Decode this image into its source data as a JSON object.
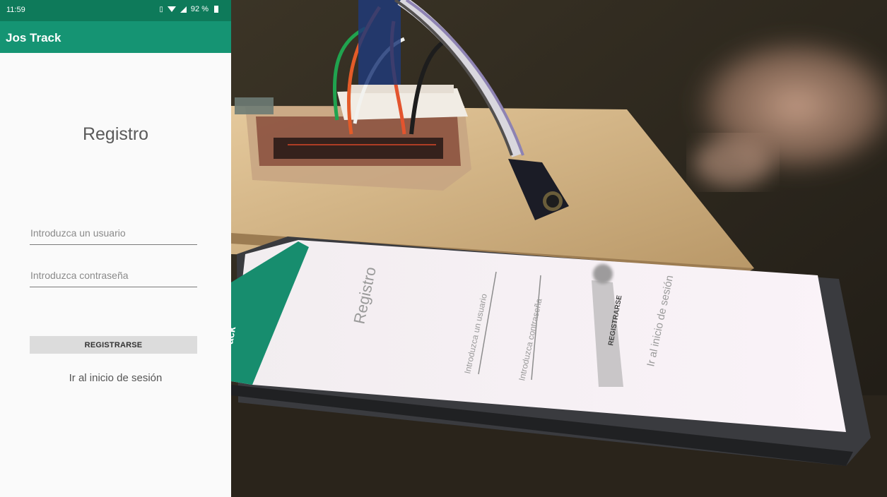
{
  "status_bar": {
    "time": "11:59",
    "battery": "92 %",
    "icons": [
      "vibrate-icon",
      "wifi-icon",
      "signal-icon",
      "battery-icon"
    ]
  },
  "app_bar": {
    "title": "Jos Track"
  },
  "form": {
    "title": "Registro",
    "user_placeholder": "Introduzca un usuario",
    "password_placeholder": "Introduzca contraseña",
    "register_button": "REGISTRARSE",
    "login_link": "Ir al inicio de sesión"
  },
  "photo": {
    "phone_screen": {
      "app_bar_text": "ack",
      "title": "Registro",
      "user_placeholder": "Introduzca un usuario",
      "password_placeholder": "Introduzca contraseña",
      "register_button": "REGISTRARSE",
      "login_link": "Ir al inicio de sesión"
    }
  },
  "colors": {
    "status_bar": "#0e7a5a",
    "app_bar": "#159473",
    "background": "#fafafa",
    "button": "#dcdcdc"
  }
}
